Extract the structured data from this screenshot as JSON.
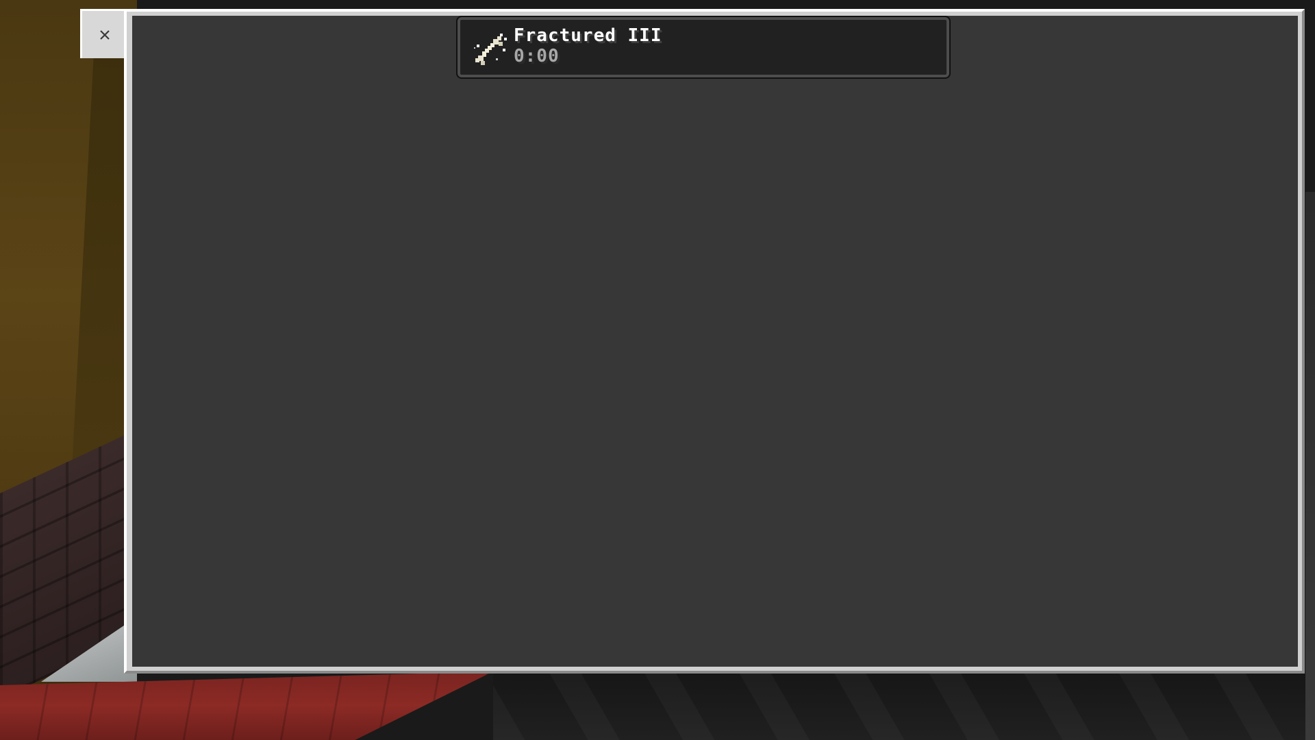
{
  "window": {
    "close_icon": "close-icon",
    "content_color": "#373737",
    "frame_color": "#d0d0d0"
  },
  "effect": {
    "name": "Fractured III",
    "timer": "0:00",
    "icon": "bone-icon"
  }
}
